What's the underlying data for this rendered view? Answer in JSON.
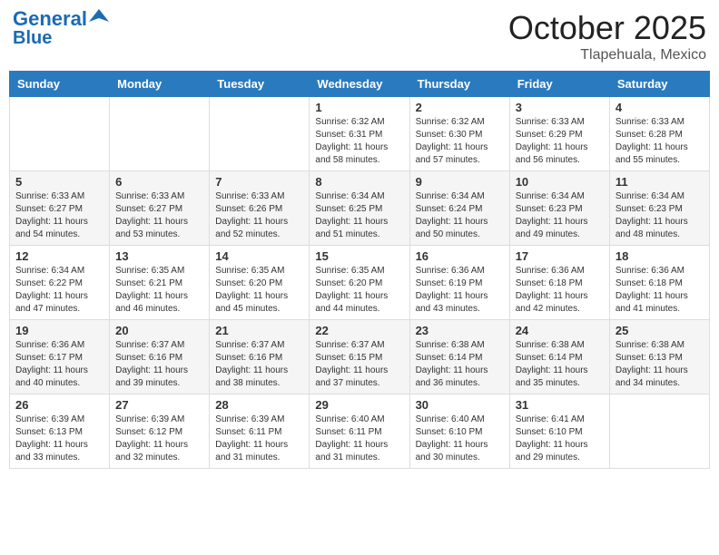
{
  "header": {
    "logo_line1": "General",
    "logo_line2": "Blue",
    "month": "October 2025",
    "location": "Tlapehuala, Mexico"
  },
  "weekdays": [
    "Sunday",
    "Monday",
    "Tuesday",
    "Wednesday",
    "Thursday",
    "Friday",
    "Saturday"
  ],
  "weeks": [
    [
      {
        "day": "",
        "info": ""
      },
      {
        "day": "",
        "info": ""
      },
      {
        "day": "",
        "info": ""
      },
      {
        "day": "1",
        "info": "Sunrise: 6:32 AM\nSunset: 6:31 PM\nDaylight: 11 hours\nand 58 minutes."
      },
      {
        "day": "2",
        "info": "Sunrise: 6:32 AM\nSunset: 6:30 PM\nDaylight: 11 hours\nand 57 minutes."
      },
      {
        "day": "3",
        "info": "Sunrise: 6:33 AM\nSunset: 6:29 PM\nDaylight: 11 hours\nand 56 minutes."
      },
      {
        "day": "4",
        "info": "Sunrise: 6:33 AM\nSunset: 6:28 PM\nDaylight: 11 hours\nand 55 minutes."
      }
    ],
    [
      {
        "day": "5",
        "info": "Sunrise: 6:33 AM\nSunset: 6:27 PM\nDaylight: 11 hours\nand 54 minutes."
      },
      {
        "day": "6",
        "info": "Sunrise: 6:33 AM\nSunset: 6:27 PM\nDaylight: 11 hours\nand 53 minutes."
      },
      {
        "day": "7",
        "info": "Sunrise: 6:33 AM\nSunset: 6:26 PM\nDaylight: 11 hours\nand 52 minutes."
      },
      {
        "day": "8",
        "info": "Sunrise: 6:34 AM\nSunset: 6:25 PM\nDaylight: 11 hours\nand 51 minutes."
      },
      {
        "day": "9",
        "info": "Sunrise: 6:34 AM\nSunset: 6:24 PM\nDaylight: 11 hours\nand 50 minutes."
      },
      {
        "day": "10",
        "info": "Sunrise: 6:34 AM\nSunset: 6:23 PM\nDaylight: 11 hours\nand 49 minutes."
      },
      {
        "day": "11",
        "info": "Sunrise: 6:34 AM\nSunset: 6:23 PM\nDaylight: 11 hours\nand 48 minutes."
      }
    ],
    [
      {
        "day": "12",
        "info": "Sunrise: 6:34 AM\nSunset: 6:22 PM\nDaylight: 11 hours\nand 47 minutes."
      },
      {
        "day": "13",
        "info": "Sunrise: 6:35 AM\nSunset: 6:21 PM\nDaylight: 11 hours\nand 46 minutes."
      },
      {
        "day": "14",
        "info": "Sunrise: 6:35 AM\nSunset: 6:20 PM\nDaylight: 11 hours\nand 45 minutes."
      },
      {
        "day": "15",
        "info": "Sunrise: 6:35 AM\nSunset: 6:20 PM\nDaylight: 11 hours\nand 44 minutes."
      },
      {
        "day": "16",
        "info": "Sunrise: 6:36 AM\nSunset: 6:19 PM\nDaylight: 11 hours\nand 43 minutes."
      },
      {
        "day": "17",
        "info": "Sunrise: 6:36 AM\nSunset: 6:18 PM\nDaylight: 11 hours\nand 42 minutes."
      },
      {
        "day": "18",
        "info": "Sunrise: 6:36 AM\nSunset: 6:18 PM\nDaylight: 11 hours\nand 41 minutes."
      }
    ],
    [
      {
        "day": "19",
        "info": "Sunrise: 6:36 AM\nSunset: 6:17 PM\nDaylight: 11 hours\nand 40 minutes."
      },
      {
        "day": "20",
        "info": "Sunrise: 6:37 AM\nSunset: 6:16 PM\nDaylight: 11 hours\nand 39 minutes."
      },
      {
        "day": "21",
        "info": "Sunrise: 6:37 AM\nSunset: 6:16 PM\nDaylight: 11 hours\nand 38 minutes."
      },
      {
        "day": "22",
        "info": "Sunrise: 6:37 AM\nSunset: 6:15 PM\nDaylight: 11 hours\nand 37 minutes."
      },
      {
        "day": "23",
        "info": "Sunrise: 6:38 AM\nSunset: 6:14 PM\nDaylight: 11 hours\nand 36 minutes."
      },
      {
        "day": "24",
        "info": "Sunrise: 6:38 AM\nSunset: 6:14 PM\nDaylight: 11 hours\nand 35 minutes."
      },
      {
        "day": "25",
        "info": "Sunrise: 6:38 AM\nSunset: 6:13 PM\nDaylight: 11 hours\nand 34 minutes."
      }
    ],
    [
      {
        "day": "26",
        "info": "Sunrise: 6:39 AM\nSunset: 6:13 PM\nDaylight: 11 hours\nand 33 minutes."
      },
      {
        "day": "27",
        "info": "Sunrise: 6:39 AM\nSunset: 6:12 PM\nDaylight: 11 hours\nand 32 minutes."
      },
      {
        "day": "28",
        "info": "Sunrise: 6:39 AM\nSunset: 6:11 PM\nDaylight: 11 hours\nand 31 minutes."
      },
      {
        "day": "29",
        "info": "Sunrise: 6:40 AM\nSunset: 6:11 PM\nDaylight: 11 hours\nand 31 minutes."
      },
      {
        "day": "30",
        "info": "Sunrise: 6:40 AM\nSunset: 6:10 PM\nDaylight: 11 hours\nand 30 minutes."
      },
      {
        "day": "31",
        "info": "Sunrise: 6:41 AM\nSunset: 6:10 PM\nDaylight: 11 hours\nand 29 minutes."
      },
      {
        "day": "",
        "info": ""
      }
    ]
  ]
}
